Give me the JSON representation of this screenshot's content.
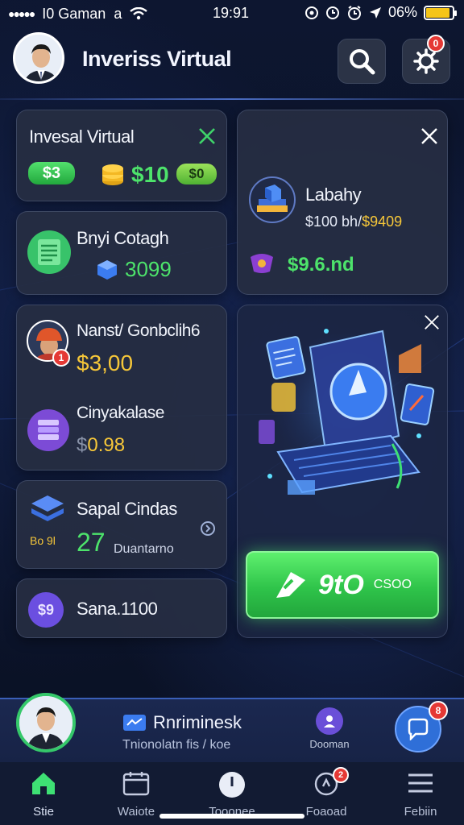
{
  "status_bar": {
    "carrier": "I0 Gaman",
    "carrier_suffix": "a",
    "time": "19:91",
    "battery": "06%",
    "battery_level": 0.9
  },
  "header": {
    "title": "Inveriss Virtual",
    "settings_badge": "0"
  },
  "cards": {
    "invest": {
      "title": "Invesal Virtual",
      "pill_left": "$3",
      "value": "$10",
      "pill_right": "$0"
    },
    "labahy": {
      "title": "Labahy",
      "price_white": "$100 bh/",
      "price_yellow": "$9409",
      "value": "$9.6.nd"
    },
    "bnyi": {
      "title": "Bnyi Cotagh",
      "value": "3099"
    },
    "nanst": {
      "title": "Nanst/ Gonbclih6",
      "badge": "1",
      "value": "$3,00",
      "sub_title": "Cinyakalase",
      "sub_prefix": "$",
      "sub_value": "0.98"
    },
    "sapal": {
      "title": "Sapal Cindas",
      "icon_caption": "Bo 9l",
      "value": "27",
      "caption": "Duantarno"
    },
    "sana": {
      "title": "Sana.1100",
      "icon_glyph": "$9"
    },
    "promo": {
      "cta_label": "9tO",
      "cta_sub": "CSOO"
    }
  },
  "profile_bar": {
    "name": "Rnriminesk",
    "subtitle": "Tnionolatn fis / koe",
    "mid_label": "Dooman",
    "chat_badge": "8"
  },
  "tabs": [
    {
      "label": "Stie",
      "icon": "home-icon",
      "active": true
    },
    {
      "label": "Waiote",
      "icon": "calendar-icon"
    },
    {
      "label": "Tooonee",
      "icon": "clock-icon"
    },
    {
      "label": "Foaoad",
      "icon": "bell-icon",
      "badge": "2"
    },
    {
      "label": "Febiin",
      "icon": "menu-icon"
    }
  ],
  "colors": {
    "background": "#0b1226",
    "card": "#262e42",
    "accent_green": "#4de36b",
    "accent_yellow": "#f6c739",
    "badge_red": "#e53935",
    "profile_bar": "#1b2850"
  }
}
